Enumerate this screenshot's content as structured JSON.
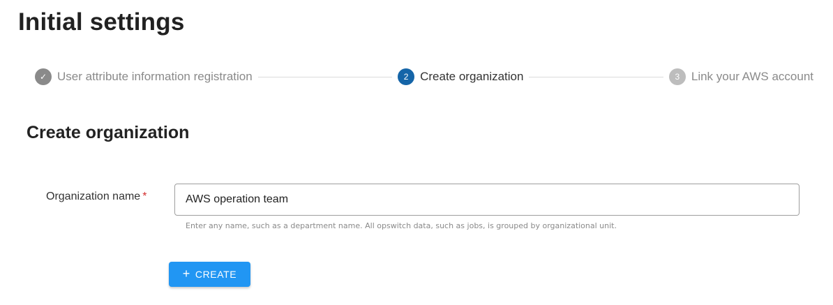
{
  "page": {
    "title": "Initial settings"
  },
  "stepper": {
    "steps": [
      {
        "badge": "✓",
        "label": "User attribute information registration",
        "state": "completed",
        "icon": "check-icon"
      },
      {
        "badge": "2",
        "label": "Create organization",
        "state": "active"
      },
      {
        "badge": "3",
        "label": "Link your AWS account",
        "state": "upcoming"
      }
    ]
  },
  "form": {
    "section_title": "Create organization",
    "organization_name": {
      "label": "Organization name",
      "required_mark": "*",
      "value": "AWS operation team",
      "hint": "Enter any name, such as a department name. All opswitch data, such as jobs, is grouped by organizational unit."
    },
    "create_button": {
      "icon": "+",
      "icon_name": "plus-icon",
      "label": "CREATE"
    }
  },
  "colors": {
    "active_step": "#1565a8",
    "completed_step": "#8a8a8a",
    "upcoming_step": "#bdbdbd",
    "primary_button": "#2196f3",
    "required": "#d32f2f"
  }
}
